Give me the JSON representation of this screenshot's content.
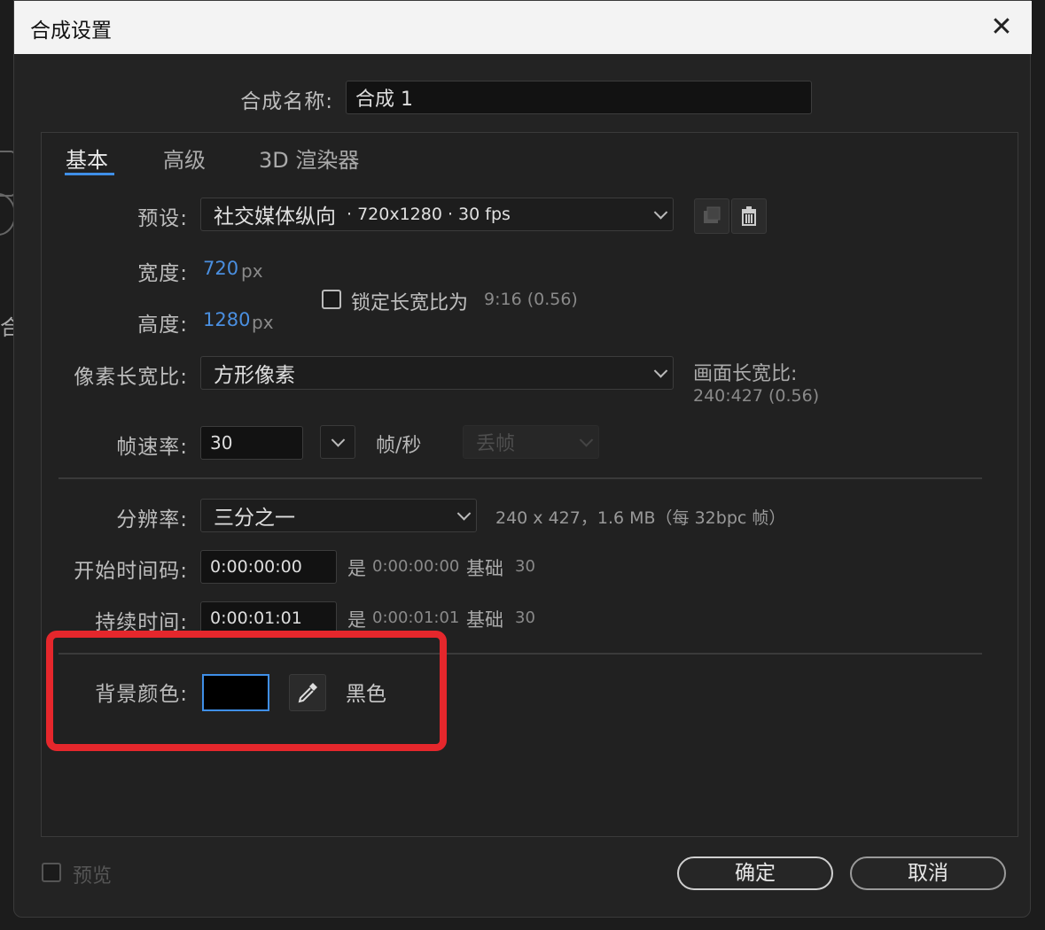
{
  "dialog": {
    "title": "合成设置",
    "close_glyph": "✕"
  },
  "comp_name": {
    "label": "合成名称:",
    "value": "合成 1"
  },
  "tabs": [
    {
      "label": "基本"
    },
    {
      "label": "高级"
    },
    {
      "label": "3D 渲染器"
    }
  ],
  "preset": {
    "label": "预设:",
    "value_name": "社交媒体纵向",
    "value_detail": "· 720x1280 · 30 fps"
  },
  "width": {
    "label": "宽度:",
    "value": "720",
    "unit": "px"
  },
  "height": {
    "label": "高度:",
    "value": "1280",
    "unit": "px"
  },
  "lock_aspect": {
    "label": "锁定长宽比为",
    "ratio": "9:16 (0.56)",
    "checked": false
  },
  "pixel_aspect": {
    "label": "像素长宽比:",
    "value": "方形像素"
  },
  "frame_aspect": {
    "label": "画面长宽比:",
    "value": "240:427 (0.56)"
  },
  "frame_rate": {
    "label": "帧速率:",
    "value": "30",
    "unit": "帧/秒",
    "drop_frame": "丢帧"
  },
  "resolution": {
    "label": "分辨率:",
    "value": "三分之一",
    "info": "240 x 427，1.6 MB（每 32bpc 帧）"
  },
  "start_timecode": {
    "label": "开始时间码:",
    "value": "0:00:00:00",
    "is_label": "是",
    "is_value": "0:00:00:00",
    "base_label": "基础",
    "base_value": "30"
  },
  "duration": {
    "label": "持续时间:",
    "value": "0:00:01:01",
    "is_label": "是",
    "is_value": "0:00:01:01",
    "base_label": "基础",
    "base_value": "30"
  },
  "background_color": {
    "label": "背景颜色:",
    "swatch": "#000000",
    "name": "黑色"
  },
  "preview": {
    "label": "预览",
    "checked": false
  },
  "buttons": {
    "ok": "确定",
    "cancel": "取消"
  },
  "left_fragment_text": "合",
  "colors": {
    "accent": "#3f8fe8",
    "value_blue": "#4a8fe0",
    "highlight": "#e5272c"
  }
}
